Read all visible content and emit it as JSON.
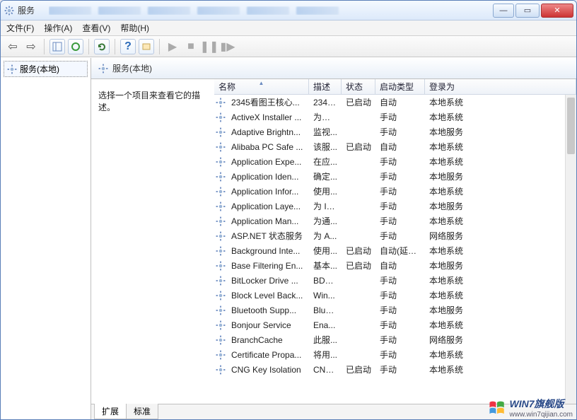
{
  "window": {
    "title": "服务"
  },
  "menu": {
    "file": "文件(F)",
    "action": "操作(A)",
    "view": "查看(V)",
    "help": "帮助(H)"
  },
  "tree": {
    "root": "服务(本地)"
  },
  "header": {
    "title": "服务(本地)"
  },
  "desc": {
    "prompt": "选择一个项目来查看它的描述。"
  },
  "columns": {
    "name": "名称",
    "desc": "描述",
    "status": "状态",
    "startup": "启动类型",
    "logon": "登录为"
  },
  "tabs": {
    "ext": "扩展",
    "std": "标准"
  },
  "services": [
    {
      "name": "2345看图王核心...",
      "desc": "2345...",
      "status": "已启动",
      "startup": "自动",
      "logon": "本地系统"
    },
    {
      "name": "ActiveX Installer ...",
      "desc": "为从 ...",
      "status": "",
      "startup": "手动",
      "logon": "本地系统"
    },
    {
      "name": "Adaptive Brightn...",
      "desc": "监视...",
      "status": "",
      "startup": "手动",
      "logon": "本地服务"
    },
    {
      "name": "Alibaba PC Safe ...",
      "desc": "该服...",
      "status": "已启动",
      "startup": "自动",
      "logon": "本地系统"
    },
    {
      "name": "Application Expe...",
      "desc": "在应...",
      "status": "",
      "startup": "手动",
      "logon": "本地系统"
    },
    {
      "name": "Application Iden...",
      "desc": "确定...",
      "status": "",
      "startup": "手动",
      "logon": "本地服务"
    },
    {
      "name": "Application Infor...",
      "desc": "使用...",
      "status": "",
      "startup": "手动",
      "logon": "本地系统"
    },
    {
      "name": "Application Laye...",
      "desc": "为 In...",
      "status": "",
      "startup": "手动",
      "logon": "本地服务"
    },
    {
      "name": "Application Man...",
      "desc": "为通...",
      "status": "",
      "startup": "手动",
      "logon": "本地系统"
    },
    {
      "name": "ASP.NET 状态服务",
      "desc": "为 A...",
      "status": "",
      "startup": "手动",
      "logon": "网络服务"
    },
    {
      "name": "Background Inte...",
      "desc": "使用...",
      "status": "已启动",
      "startup": "自动(延迟...",
      "logon": "本地系统"
    },
    {
      "name": "Base Filtering En...",
      "desc": "基本...",
      "status": "已启动",
      "startup": "自动",
      "logon": "本地服务"
    },
    {
      "name": "BitLocker Drive ...",
      "desc": "BDE...",
      "status": "",
      "startup": "手动",
      "logon": "本地系统"
    },
    {
      "name": "Block Level Back...",
      "desc": "Win...",
      "status": "",
      "startup": "手动",
      "logon": "本地系统"
    },
    {
      "name": "Bluetooth Supp...",
      "desc": "Blue...",
      "status": "",
      "startup": "手动",
      "logon": "本地服务"
    },
    {
      "name": "Bonjour Service",
      "desc": "Ena...",
      "status": "",
      "startup": "手动",
      "logon": "本地系统"
    },
    {
      "name": "BranchCache",
      "desc": "此服...",
      "status": "",
      "startup": "手动",
      "logon": "网络服务"
    },
    {
      "name": "Certificate Propa...",
      "desc": "将用...",
      "status": "",
      "startup": "手动",
      "logon": "本地系统"
    },
    {
      "name": "CNG Key Isolation",
      "desc": "CNG...",
      "status": "已启动",
      "startup": "手动",
      "logon": "本地系统"
    }
  ],
  "watermark": {
    "brand": "WIN7旗舰版",
    "url": "www.win7qijian.com"
  }
}
